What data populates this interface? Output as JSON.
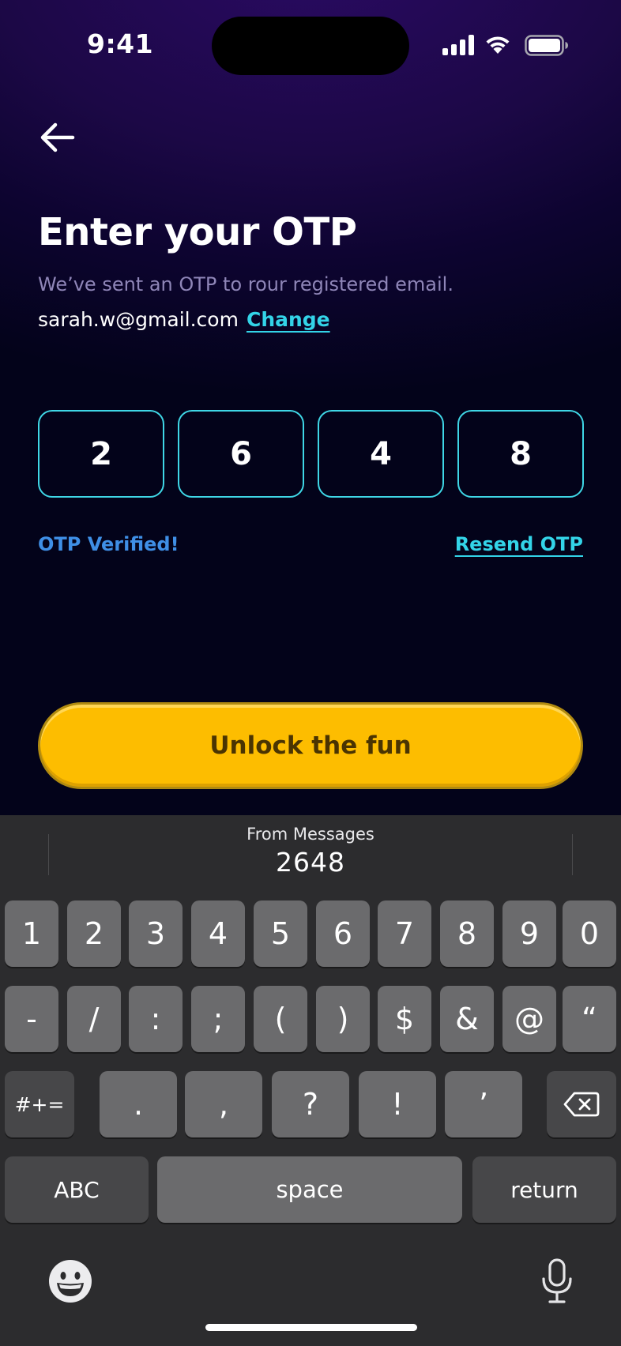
{
  "status_bar": {
    "time": "9:41"
  },
  "header": {
    "title": "Enter your OTP",
    "subtitle": "We’ve sent an OTP to rour registered email.",
    "email": "sarah.w@gmail.com",
    "change_label": "Change"
  },
  "otp": {
    "digits": [
      "2",
      "6",
      "4",
      "8"
    ]
  },
  "status": {
    "verified_text": "OTP Verified!",
    "resend_label": "Resend OTP"
  },
  "cta": {
    "label": "Unlock the fun"
  },
  "keyboard": {
    "suggestion_source": "From Messages",
    "suggestion_code": "2648",
    "row1": [
      "1",
      "2",
      "3",
      "4",
      "5",
      "6",
      "7",
      "8",
      "9",
      "0"
    ],
    "row2": [
      "-",
      "/",
      ":",
      ";",
      "(",
      ")",
      "$",
      "&",
      "@",
      "“"
    ],
    "row3_toggle": "#+=",
    "row3": [
      ".",
      ",",
      "?",
      "!",
      "’"
    ],
    "abc_label": "ABC",
    "space_label": "space",
    "return_label": "return"
  },
  "colors": {
    "accent_cyan": "#3fd7e6",
    "verified_blue": "#3f8fe6",
    "cta_yellow": "#fdbd00",
    "background_purple": "#2a0a63"
  },
  "icons": [
    "back-arrow-icon",
    "cellular-signal-icon",
    "wifi-icon",
    "battery-icon",
    "delete-icon",
    "emoji-icon",
    "microphone-icon"
  ]
}
